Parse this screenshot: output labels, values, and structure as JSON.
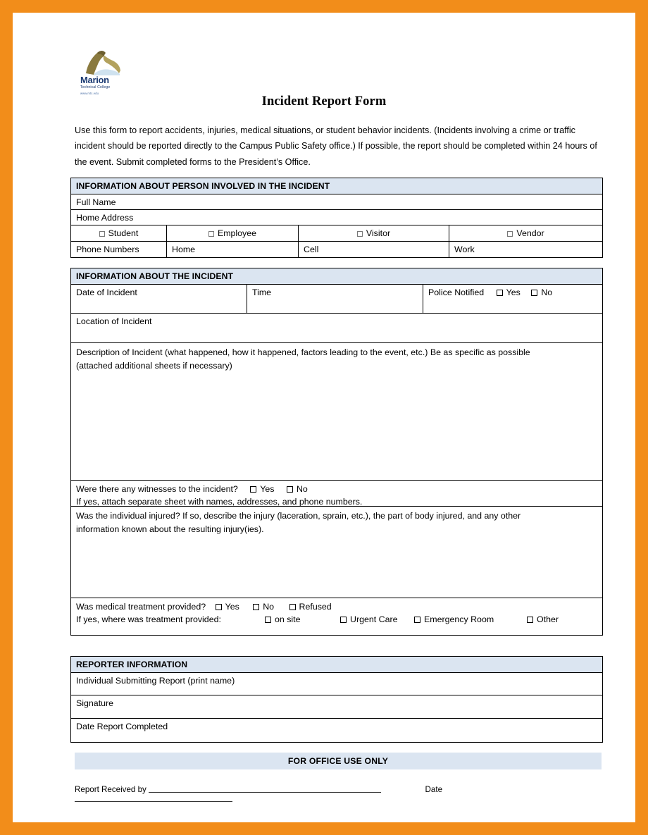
{
  "logo": {
    "name": "Marion",
    "subtitle": "Technical College",
    "url": "www.mtc.edu",
    "icon": "marion-eagle-logo"
  },
  "title": "Incident Report Form",
  "intro": "Use this form to report accidents, injuries, medical situations, or student behavior incidents. (Incidents involving a crime or traffic incident should be reported directly to the Campus Public Safety office.) If possible, the report should be completed within 24 hours of the event. Submit completed forms to the President’s Office.",
  "colors": {
    "page_border": "#f28d1a",
    "section_header_bg": "#dbe5f1",
    "logo_blue": "#1b3a72"
  },
  "person_section": {
    "header": "INFORMATION ABOUT PERSON INVOLVED IN THE INCIDENT",
    "full_name_label": "Full Name",
    "home_address_label": "Home Address",
    "role_options": [
      "Student",
      "Employee",
      "Visitor",
      "Vendor"
    ],
    "phone_label": "Phone Numbers",
    "phone_types": [
      "Home",
      "Cell",
      "Work"
    ]
  },
  "incident_section": {
    "header": "INFORMATION ABOUT THE INCIDENT",
    "date_label": "Date of Incident",
    "time_label": "Time",
    "police_label": "Police Notified",
    "police_options": [
      "Yes",
      "No"
    ],
    "location_label": "Location of Incident",
    "description_line1": "Description of Incident (what happened, how it happened, factors leading to the event, etc.) Be as specific as possible",
    "description_line2": "(attached additional sheets if necessary)",
    "witness_question": "Were there any witnesses to the incident?",
    "witness_options": [
      "Yes",
      "No"
    ],
    "witness_note": "If yes, attach separate sheet with names, addresses, and phone numbers.",
    "injury_line1": "Was the individual injured? If so, describe the injury (laceration, sprain, etc.), the part of body injured, and any other",
    "injury_line2": "information known about the resulting injury(ies).",
    "treatment_question": "Was medical treatment provided?",
    "treatment_options": [
      "Yes",
      "No",
      "Refused"
    ],
    "treatment_where_label": "If yes, where was treatment provided:",
    "treatment_where_options": [
      "on site",
      "Urgent Care",
      "Emergency Room",
      "Other"
    ]
  },
  "reporter_section": {
    "header": "REPORTER INFORMATION",
    "individual_label": "Individual Submitting Report (print name)",
    "signature_label": "Signature",
    "date_completed_label": "Date Report Completed"
  },
  "office_section": {
    "header": "FOR OFFICE USE ONLY",
    "received_by_label": "Report Received by",
    "date_label": "Date"
  }
}
